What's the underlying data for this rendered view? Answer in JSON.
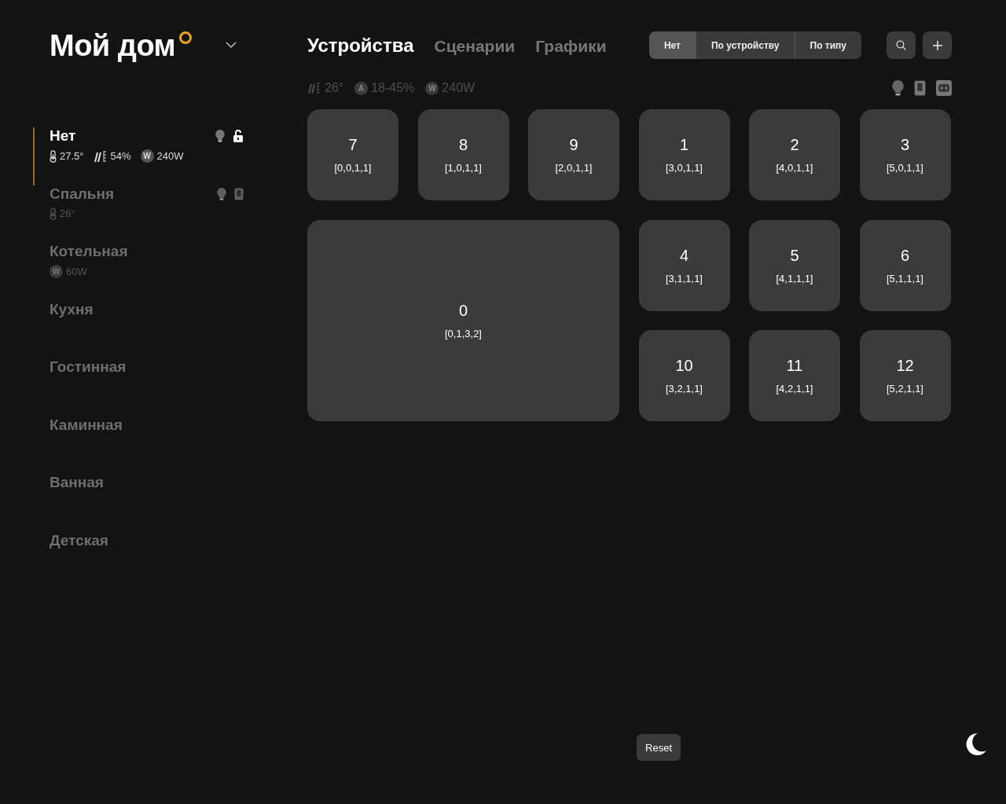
{
  "home": {
    "title": "Мой дом"
  },
  "rooms": [
    {
      "name": "Нет",
      "selected": true,
      "sensors": [
        {
          "kind": "temperature",
          "value": "27.5°"
        },
        {
          "kind": "humidity",
          "value": "54%"
        },
        {
          "kind": "badge",
          "badge": "W",
          "value": "240W"
        }
      ],
      "devices": [
        {
          "kind": "bulb"
        },
        {
          "kind": "lock"
        }
      ]
    },
    {
      "name": "Спальня",
      "selected": false,
      "sensors": [
        {
          "kind": "temperature",
          "value": "26°"
        }
      ],
      "devices": [
        {
          "kind": "bulb"
        },
        {
          "kind": "switch"
        }
      ]
    },
    {
      "name": "Котельная",
      "selected": false,
      "sensors": [
        {
          "kind": "badge",
          "badge": "W",
          "value": "60W"
        }
      ]
    },
    {
      "name": "Кухня",
      "selected": false
    },
    {
      "name": "Гостинная",
      "selected": false
    },
    {
      "name": "Каминная",
      "selected": false
    },
    {
      "name": "Ванная",
      "selected": false
    },
    {
      "name": "Детская",
      "selected": false
    }
  ],
  "tabs": [
    {
      "label": "Устройства",
      "selected": true
    },
    {
      "label": "Сценарии",
      "selected": false
    },
    {
      "label": "Графики",
      "selected": false
    }
  ],
  "grouping": [
    {
      "label": "Нет",
      "selected": true
    },
    {
      "label": "По устройству",
      "selected": false
    },
    {
      "label": "По типу",
      "selected": false
    }
  ],
  "summary": {
    "sensors": [
      {
        "kind": "humidity",
        "value": "26°"
      },
      {
        "kind": "badge",
        "badge": "A",
        "value": "18-45%"
      },
      {
        "kind": "badge",
        "badge": "W",
        "value": "240W"
      }
    ],
    "device_types": [
      {
        "kind": "bulb"
      },
      {
        "kind": "switch"
      },
      {
        "kind": "socket"
      }
    ]
  },
  "tiles": [
    {
      "number": "7",
      "position": "[0,0,1,1]",
      "kind": "small"
    },
    {
      "number": "8",
      "position": "[1,0,1,1]",
      "kind": "small"
    },
    {
      "number": "9",
      "position": "[2,0,1,1]",
      "kind": "small"
    },
    {
      "number": "1",
      "position": "[3,0,1,1]",
      "kind": "small"
    },
    {
      "number": "2",
      "position": "[4,0,1,1]",
      "kind": "small"
    },
    {
      "number": "3",
      "position": "[5,0,1,1]",
      "kind": "small"
    },
    {
      "number": "0",
      "position": "[0,1,3,2]",
      "kind": "large"
    },
    {
      "number": "4",
      "position": "[3,1,1,1]",
      "kind": "small"
    },
    {
      "number": "5",
      "position": "[4,1,1,1]",
      "kind": "small"
    },
    {
      "number": "6",
      "position": "[5,1,1,1]",
      "kind": "small"
    },
    {
      "number": "10",
      "position": "[3,2,1,1]",
      "kind": "small"
    },
    {
      "number": "11",
      "position": "[4,2,1,1]",
      "kind": "small"
    },
    {
      "number": "12",
      "position": "[5,2,1,1]",
      "kind": "small"
    }
  ],
  "reset_button": "Reset"
}
